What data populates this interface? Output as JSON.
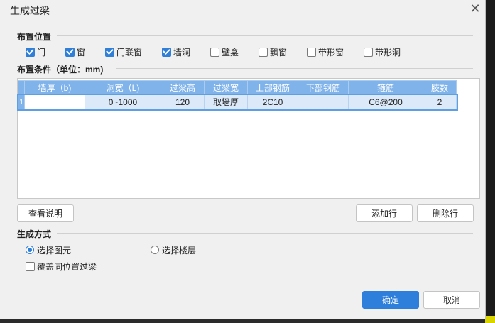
{
  "dialog": {
    "title": "生成过梁",
    "close_glyph": "✕"
  },
  "placement": {
    "label": "布置位置",
    "options": [
      {
        "label": "门",
        "checked": true
      },
      {
        "label": "窗",
        "checked": true
      },
      {
        "label": "门联窗",
        "checked": true
      },
      {
        "label": "墙洞",
        "checked": true
      },
      {
        "label": "壁龛",
        "checked": false
      },
      {
        "label": "飘窗",
        "checked": false
      },
      {
        "label": "带形窗",
        "checked": false
      },
      {
        "label": "带形洞",
        "checked": false
      }
    ]
  },
  "conditions": {
    "label": "布置条件（单位：mm)",
    "columns": [
      "墙厚（b)",
      "洞宽（L)",
      "过梁高",
      "过梁宽",
      "上部钢筋",
      "下部钢筋",
      "箍筋",
      "肢数"
    ],
    "rows": [
      {
        "num": "1",
        "cells": [
          "",
          "0~1000",
          "120",
          "取墙厚",
          "2C10",
          "",
          "C6@200",
          "2"
        ]
      }
    ]
  },
  "buttons": {
    "help": "查看说明",
    "add_row": "添加行",
    "delete_row": "删除行",
    "ok": "确定",
    "cancel": "取消"
  },
  "generate": {
    "label": "生成方式",
    "radio_select_elements": "选择图元",
    "radio_select_floors": "选择楼层",
    "selected": "选择图元",
    "overwrite_label": "覆盖同位置过梁",
    "overwrite_checked": false
  },
  "colors": {
    "accent": "#2e7fdc",
    "header": "#7fb3ea",
    "selected_row": "#dce9f8"
  }
}
